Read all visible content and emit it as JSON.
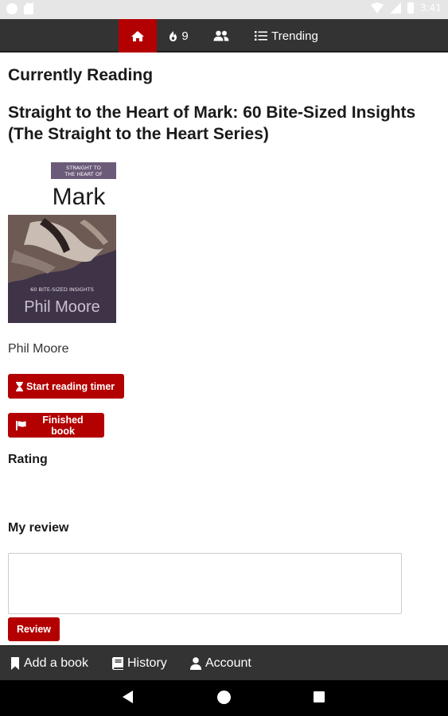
{
  "status_bar": {
    "time": "3:41"
  },
  "top_nav": {
    "home_icon": "home-icon",
    "streak_icon": "flame-icon",
    "streak_count": "9",
    "friends_icon": "users-icon",
    "trending_icon": "list-icon",
    "trending_label": "Trending",
    "active_color": "#b30000"
  },
  "main": {
    "page_title": "Currently Reading",
    "book": {
      "title": "Straight to the Heart of Mark: 60 Bite-Sized Insights (The Straight to the Heart Series)",
      "author": "Phil Moore",
      "cover": {
        "series_line1": "STRAIGHT TO",
        "series_line2": "THE HEART OF",
        "name": "Mark",
        "subtitle": "60 BITE-SIZED INSIGHTS",
        "author": "Phil Moore"
      }
    },
    "buttons": {
      "start_timer": "Start reading timer",
      "start_timer_icon": "hourglass-icon",
      "finished": "Finished book",
      "finished_icon": "flag-icon",
      "review": "Review"
    },
    "rating_label": "Rating",
    "review_label": "My review",
    "review_value": "",
    "review_placeholder": ""
  },
  "bottom_bar": {
    "add_book": "Add a book",
    "add_book_icon": "bookmark-icon",
    "history": "History",
    "history_icon": "book-icon",
    "account": "Account",
    "account_icon": "user-icon"
  },
  "colors": {
    "accent": "#b30000",
    "nav_bg": "#333333"
  }
}
